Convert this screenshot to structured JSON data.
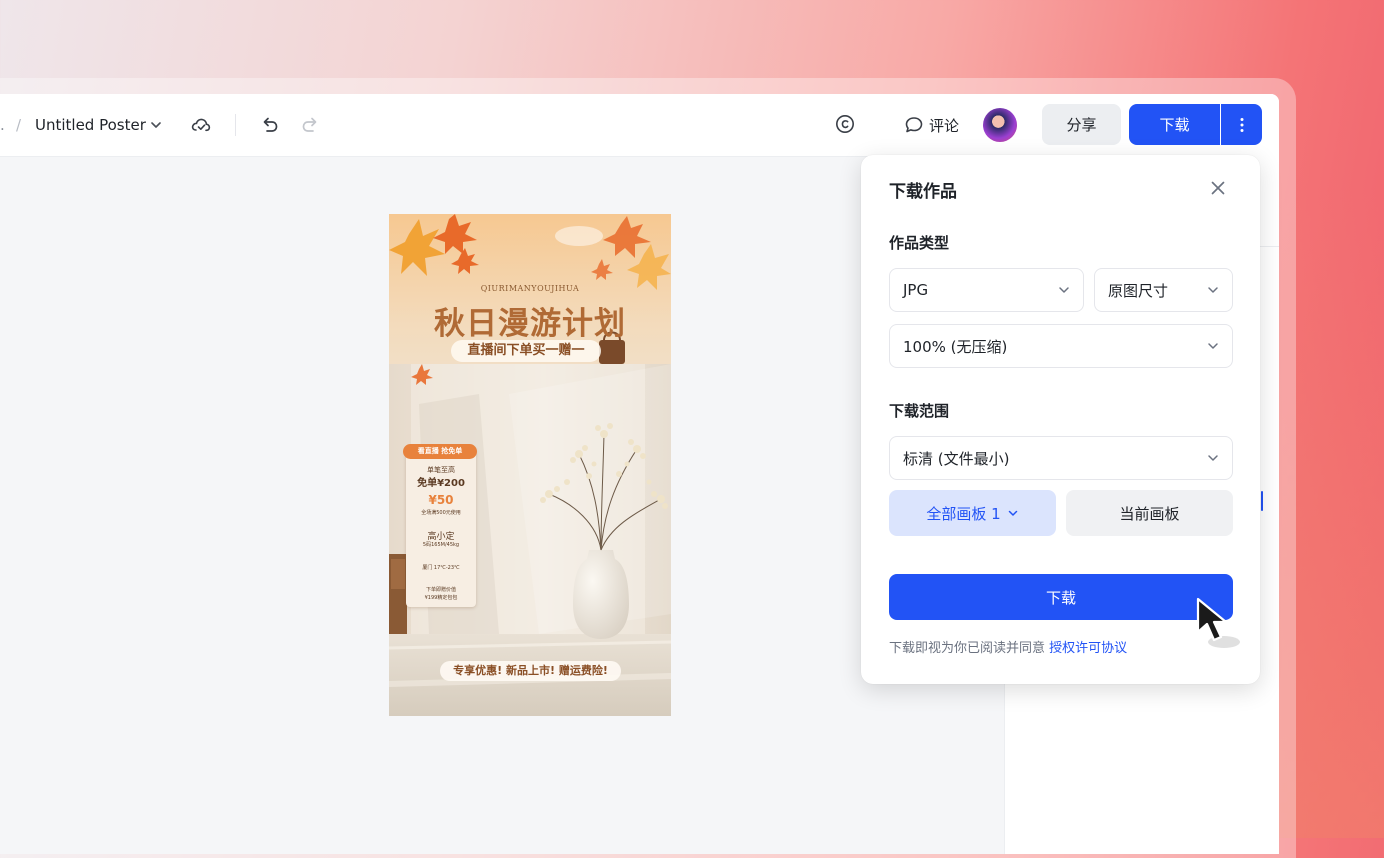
{
  "toolbar": {
    "breadcrumb_prefix": ".",
    "breadcrumb_sep": "/",
    "doc_title": "Untitled Poster",
    "comment_label": "评论",
    "share_label": "分享",
    "download_label": "下载"
  },
  "poster": {
    "en_text": "QIURIMANYOUJIHUA",
    "title": "秋日漫游计划",
    "subtitle": "直播间下单买一赠一",
    "promo_head": "看直播 抢免单",
    "promo_lines": [
      "单笔至高",
      "免单¥200",
      "¥50",
      "全场满500元使用",
      "高小定",
      "5码165M/45kg",
      "厦门 17℃-23℃",
      "下单即赠价值",
      "¥199精定包包"
    ],
    "bottom_banner": "专享优惠! 新品上市! 赠运费险!"
  },
  "dialog": {
    "title": "下载作品",
    "type_label": "作品类型",
    "format_value": "JPG",
    "size_value": "原图尺寸",
    "quality_value": "100% (无压缩)",
    "range_label": "下载范围",
    "resolution_value": "标清 (文件最小)",
    "all_boards_label": "全部画板 1",
    "current_board_label": "当前画板",
    "download_button": "下载",
    "agreement_text": "下载即视为你已阅读并同意",
    "agreement_link": "授权许可协议"
  },
  "colors": {
    "accent": "#2253f5",
    "accent_light": "#dbe4fd"
  }
}
